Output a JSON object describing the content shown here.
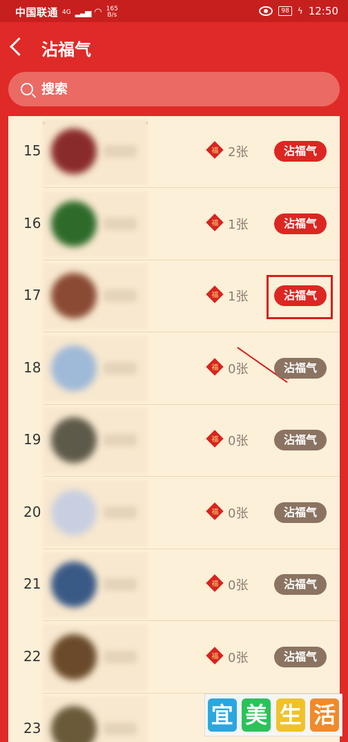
{
  "status_bar": {
    "carrier": "中国联通",
    "network": "4G",
    "speed": "165",
    "speed_unit": "B/s",
    "battery": "98",
    "time": "12:50"
  },
  "header": {
    "title": "沾福气"
  },
  "search": {
    "placeholder": "搜索"
  },
  "rows": [
    {
      "rank": "15",
      "count": "2张",
      "button": "沾福气",
      "state": "active",
      "avatar_color": "#8a2b2b"
    },
    {
      "rank": "16",
      "count": "1张",
      "button": "沾福气",
      "state": "active",
      "avatar_color": "#2e6b2a"
    },
    {
      "rank": "17",
      "count": "1张",
      "button": "沾福气",
      "state": "active",
      "avatar_color": "#8a4a33"
    },
    {
      "rank": "18",
      "count": "0张",
      "button": "沾福气",
      "state": "inactive",
      "avatar_color": "#9fb9d8"
    },
    {
      "rank": "19",
      "count": "0张",
      "button": "沾福气",
      "state": "inactive",
      "avatar_color": "#5e5a4a"
    },
    {
      "rank": "20",
      "count": "0张",
      "button": "沾福气",
      "state": "inactive",
      "avatar_color": "#c8cfe0"
    },
    {
      "rank": "21",
      "count": "0张",
      "button": "沾福气",
      "state": "inactive",
      "avatar_color": "#3a5a86"
    },
    {
      "rank": "22",
      "count": "0张",
      "button": "沾福气",
      "state": "inactive",
      "avatar_color": "#6a4a2a"
    },
    {
      "rank": "23",
      "count": "",
      "button": "",
      "state": "inactive",
      "avatar_color": "#6a5a3a"
    }
  ],
  "fu_icon_text": "福",
  "watermark": {
    "chars": [
      "宜",
      "美",
      "生",
      "活"
    ],
    "colors": [
      "#2aa7e0",
      "#2cc25a",
      "#f0c22a",
      "#f08a2a"
    ]
  }
}
